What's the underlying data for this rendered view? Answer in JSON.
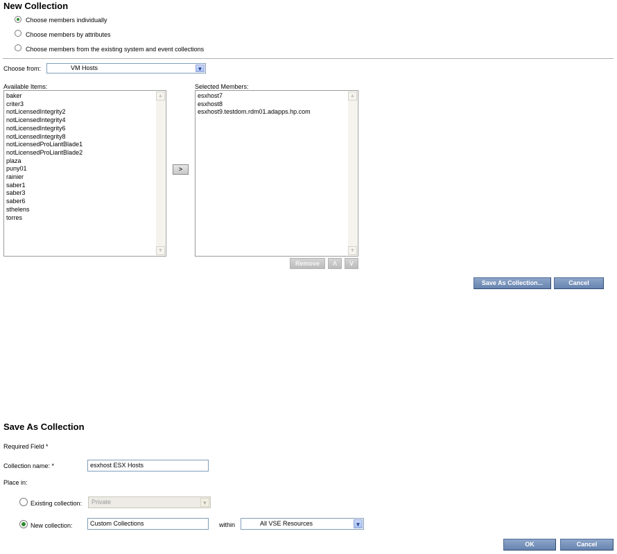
{
  "new_collection": {
    "title": "New Collection",
    "options": [
      {
        "label": "Choose members individually",
        "selected": true
      },
      {
        "label": "Choose members by attributes",
        "selected": false
      },
      {
        "label": "Choose members from the existing system and event collections",
        "selected": false
      }
    ],
    "choose_from_label": "Choose from:",
    "choose_from_value": "VM Hosts",
    "available_label": "Available Items:",
    "available_items": [
      "baker",
      "criter3",
      "notLicensedIntegrity2",
      "notLicensedIntegrity4",
      "notLicensedIntegrity6",
      "notLicensedIntegrity8",
      "notLicensedProLiantBlade1",
      "notLicensedProLiantBlade2",
      "plaza",
      "puny01",
      "rainier",
      "saber1",
      "saber3",
      "saber6",
      "sthelens",
      "torres"
    ],
    "add_button": ">",
    "selected_label": "Selected Members:",
    "selected_items": [
      "esxhost7",
      "esxhost8",
      "esxhost9.testdom.rdm01.adapps.hp.com"
    ],
    "remove_button": "Remove",
    "up_button": "Λ",
    "down_button": "V",
    "save_as_button": "Save As Collection...",
    "cancel_button": "Cancel"
  },
  "save_as": {
    "title": "Save As Collection",
    "required_note": "Required Field *",
    "collection_name_label": "Collection name: *",
    "collection_name_value": "esxhost ESX Hosts",
    "place_in_label": "Place in:",
    "existing_label": "Existing collection:",
    "existing_selected": false,
    "existing_value": "Private",
    "new_label": "New collection:",
    "new_selected": true,
    "new_value": "Custom Collections",
    "within_label": "within",
    "within_value": "All VSE Resources",
    "ok_button": "OK",
    "cancel_button": "Cancel"
  }
}
